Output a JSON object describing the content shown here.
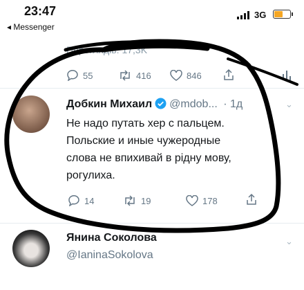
{
  "status_bar": {
    "time": "23:47",
    "back_app": "◂ Messenger",
    "network": "3G",
    "battery_level": 0.55,
    "battery_color": "#f5a623"
  },
  "previous_tweet": {
    "views": "Переглядів: 17,3K",
    "actions": {
      "replies": "55",
      "retweets": "416",
      "likes": "846"
    }
  },
  "tweet": {
    "author_name": "Добкин Михаил",
    "handle": "@mdob...",
    "time": "· 1д",
    "verified_icon": "verified-badge-icon",
    "text_lines": [
      "Не надо путать хер с пальцем.",
      "Польские и иные чужеродные",
      "слова не впихивай в рідну мову,",
      "рогулиха."
    ],
    "actions": {
      "replies": "14",
      "retweets": "19",
      "likes": "178"
    }
  },
  "next_tweet": {
    "author_name": "Янина Соколова",
    "handle": "@IaninaSokolova"
  },
  "colors": {
    "text": "#14171a",
    "secondary": "#657786",
    "verified": "#1da1f2",
    "ink": "#000000"
  }
}
